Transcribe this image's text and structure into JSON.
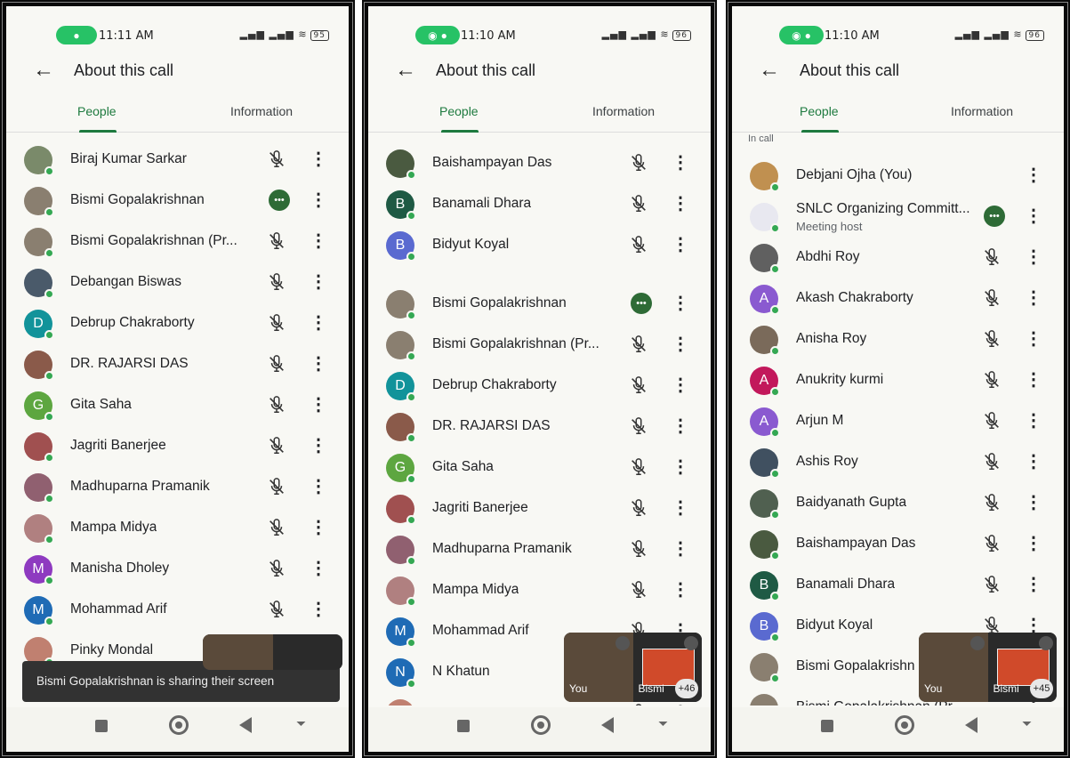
{
  "screens": [
    {
      "time": "11:11 AM",
      "battery": "95",
      "title": "About this call",
      "tabs": [
        "People",
        "Information"
      ],
      "section_label": "",
      "participants": [
        {
          "name": "Biraj Kumar Sarkar",
          "initial": "",
          "color": "#7a8a6a",
          "state": "muted"
        },
        {
          "name": "Bismi Gopalakrishnan",
          "initial": "",
          "color": "#8a7f70",
          "state": "speaking"
        },
        {
          "name": "Bismi Gopalakrishnan (Pr...",
          "initial": "",
          "color": "#8a7f70",
          "state": "muted"
        },
        {
          "name": "Debangan Biswas",
          "initial": "",
          "color": "#4a5a6a",
          "state": "muted"
        },
        {
          "name": "Debrup Chakraborty",
          "initial": "D",
          "color": "#12939a",
          "state": "muted"
        },
        {
          "name": "DR. RAJARSI DAS",
          "initial": "",
          "color": "#8a5a4a",
          "state": "muted"
        },
        {
          "name": "Gita Saha",
          "initial": "G",
          "color": "#5da640",
          "state": "muted"
        },
        {
          "name": "Jagriti Banerjee",
          "initial": "",
          "color": "#a05050",
          "state": "muted"
        },
        {
          "name": "Madhuparna Pramanik",
          "initial": "",
          "color": "#906070",
          "state": "muted"
        },
        {
          "name": "Mampa Midya",
          "initial": "",
          "color": "#b08080",
          "state": "muted"
        },
        {
          "name": "Manisha Dholey",
          "initial": "M",
          "color": "#8e3ac0",
          "state": "muted"
        },
        {
          "name": "Mohammad Arif",
          "initial": "M",
          "color": "#1f6bb5",
          "state": "muted"
        },
        {
          "name": "Pinky Mondal",
          "initial": "",
          "color": "#c08070",
          "state": "none"
        }
      ],
      "toast": "Bismi Gopalakrishnan is sharing their screen",
      "pip": null
    },
    {
      "time": "11:10 AM",
      "battery": "96",
      "title": "About this call",
      "tabs": [
        "People",
        "Information"
      ],
      "section_label": "",
      "participants": [
        {
          "name": "Baishampayan Das",
          "initial": "",
          "color": "#4a5a40",
          "state": "muted"
        },
        {
          "name": "Banamali Dhara",
          "initial": "B",
          "color": "#1f5a44",
          "state": "muted"
        },
        {
          "name": "Bidyut Koyal",
          "initial": "B",
          "color": "#5a6ad0",
          "state": "muted"
        },
        {
          "name": "Bismi Gopalakrishnan",
          "initial": "",
          "color": "#8a7f70",
          "state": "speaking"
        },
        {
          "name": "Bismi Gopalakrishnan (Pr...",
          "initial": "",
          "color": "#8a7f70",
          "state": "muted"
        },
        {
          "name": "Debrup Chakraborty",
          "initial": "D",
          "color": "#12939a",
          "state": "muted"
        },
        {
          "name": "DR. RAJARSI DAS",
          "initial": "",
          "color": "#8a5a4a",
          "state": "muted"
        },
        {
          "name": "Gita Saha",
          "initial": "G",
          "color": "#5da640",
          "state": "muted"
        },
        {
          "name": "Jagriti Banerjee",
          "initial": "",
          "color": "#a05050",
          "state": "muted"
        },
        {
          "name": "Madhuparna Pramanik",
          "initial": "",
          "color": "#906070",
          "state": "muted"
        },
        {
          "name": "Mampa Midya",
          "initial": "",
          "color": "#b08080",
          "state": "muted"
        },
        {
          "name": "Mohammad Arif",
          "initial": "M",
          "color": "#1f6bb5",
          "state": "muted"
        },
        {
          "name": "N Khatun",
          "initial": "N",
          "color": "#1f6bb5",
          "state": "muted"
        },
        {
          "name": "Pinky Mondal",
          "initial": "",
          "color": "#c08070",
          "state": "muted"
        }
      ],
      "toast": "",
      "pip": {
        "you_label": "You",
        "other_label": "Bismi",
        "badge": "+46"
      }
    },
    {
      "time": "11:10 AM",
      "battery": "96",
      "title": "About this call",
      "tabs": [
        "People",
        "Information"
      ],
      "section_label": "In call",
      "participants": [
        {
          "name": "Debjani Ojha (You)",
          "initial": "",
          "color": "#c09050",
          "state": "none"
        },
        {
          "name": "SNLC Organizing Committ...",
          "sub": "Meeting host",
          "initial": "",
          "color": "#e8e8f0",
          "state": "speaking"
        },
        {
          "name": "Abdhi Roy",
          "initial": "",
          "color": "#606060",
          "state": "muted"
        },
        {
          "name": "Akash Chakraborty",
          "initial": "A",
          "color": "#8a5ad0",
          "state": "muted"
        },
        {
          "name": "Anisha Roy",
          "initial": "",
          "color": "#7a6a5a",
          "state": "muted"
        },
        {
          "name": "Anukrity kurmi",
          "initial": "A",
          "color": "#c2185b",
          "state": "muted"
        },
        {
          "name": "Arjun M",
          "initial": "A",
          "color": "#8a5ad0",
          "state": "muted"
        },
        {
          "name": "Ashis Roy",
          "initial": "",
          "color": "#405060",
          "state": "muted"
        },
        {
          "name": "Baidyanath Gupta",
          "initial": "",
          "color": "#506050",
          "state": "muted"
        },
        {
          "name": "Baishampayan Das",
          "initial": "",
          "color": "#4a5a40",
          "state": "muted"
        },
        {
          "name": "Banamali Dhara",
          "initial": "B",
          "color": "#1f5a44",
          "state": "muted"
        },
        {
          "name": "Bidyut Koyal",
          "initial": "B",
          "color": "#5a6ad0",
          "state": "muted"
        },
        {
          "name": "Bismi Gopalakrishn",
          "initial": "",
          "color": "#8a7f70",
          "state": "none"
        },
        {
          "name": "Bismi Gopalakrishnan (Pr...",
          "initial": "",
          "color": "#8a7f70",
          "state": "none"
        }
      ],
      "toast": "",
      "pip": {
        "you_label": "You",
        "other_label": "Bismi",
        "badge": "+45"
      }
    }
  ]
}
